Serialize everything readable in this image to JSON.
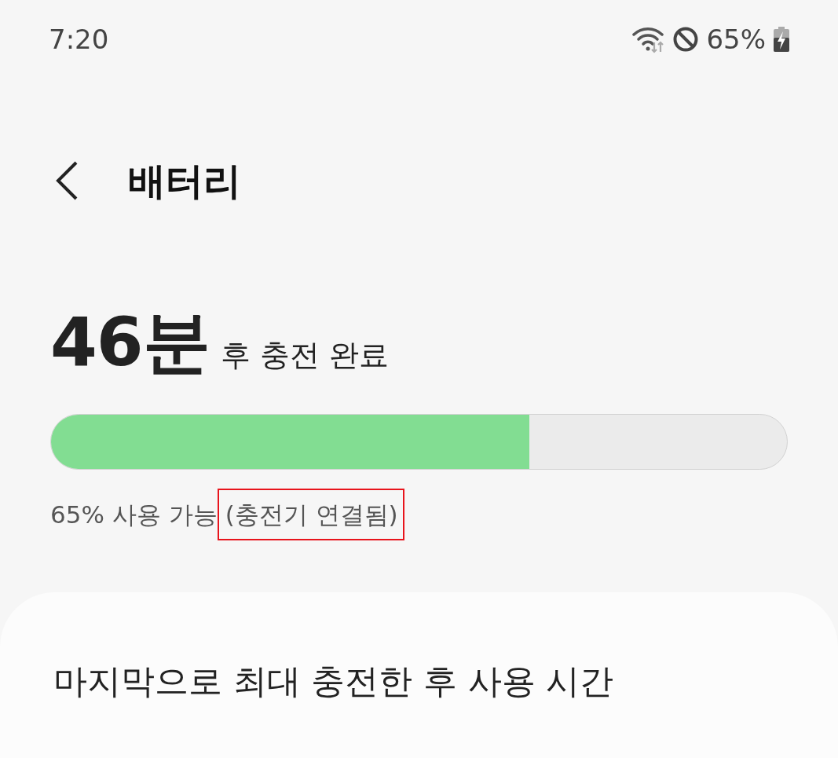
{
  "status_bar": {
    "time": "7:20",
    "battery_text": "65%",
    "charging": true
  },
  "header": {
    "title": "배터리"
  },
  "summary": {
    "time_value": "46분",
    "time_caption": "후 충전 완료",
    "level": 0.65,
    "availability": "65% 사용 가능",
    "charger_status": "(충전기 연결됨)",
    "charger_status_highlighted": true
  },
  "card": {
    "title": "마지막으로 최대 충전한 후 사용 시간"
  }
}
